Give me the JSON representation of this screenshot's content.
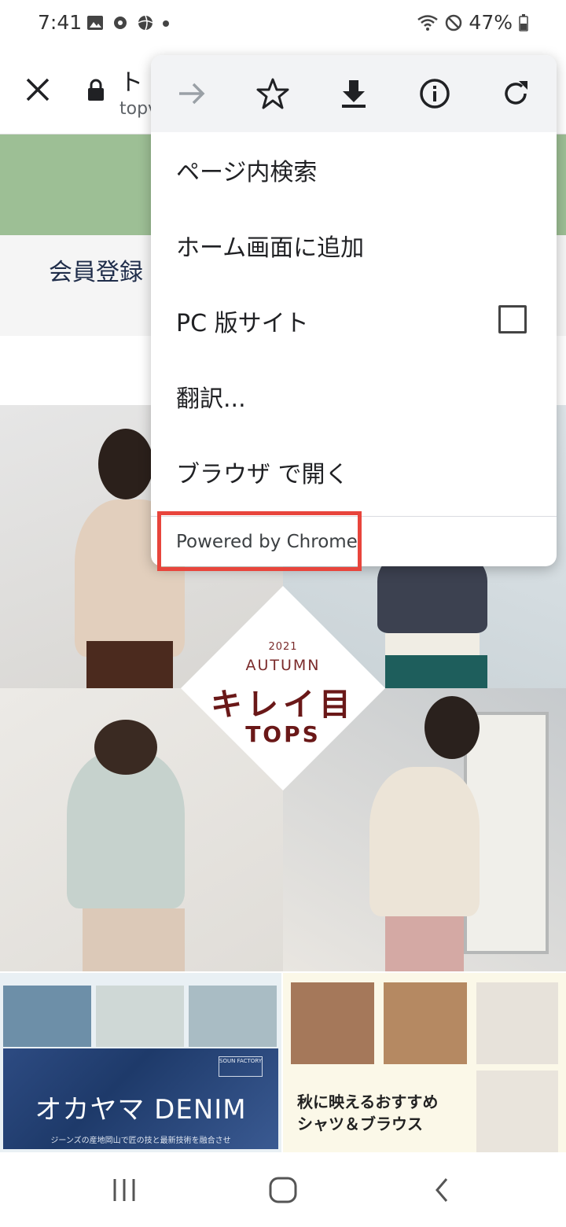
{
  "status_bar": {
    "time": "7:41",
    "battery": "47%"
  },
  "toolbar": {
    "title": "ト",
    "url": "topv"
  },
  "page": {
    "member_text": "会員登録",
    "hero": {
      "year": "2021",
      "season": "AUTUMN",
      "headline": "キレイ目",
      "tops": "TOPS"
    },
    "banner_left": {
      "logo": "オカヤマ DENIM",
      "caption": "ジーンズの産地岡山で匠の技と最新技術を融合させ",
      "badge": "SOUN FACTORY"
    },
    "banner_right": {
      "line1": "秋に映えるおすすめ",
      "line2": "シャツ＆ブラウス"
    }
  },
  "menu": {
    "icons": [
      "forward-icon",
      "star-icon",
      "download-icon",
      "info-icon",
      "reload-icon"
    ],
    "items": [
      {
        "label": "ページ内検索"
      },
      {
        "label": "ホーム画面に追加"
      },
      {
        "label": "PC 版サイト",
        "checked": false
      },
      {
        "label": "翻訳..."
      },
      {
        "label": "ブラウザ で開く"
      }
    ],
    "powered": "Powered by Chrome"
  },
  "colors": {
    "highlight": "#e8453c",
    "accent_green": "#9dbf95"
  }
}
